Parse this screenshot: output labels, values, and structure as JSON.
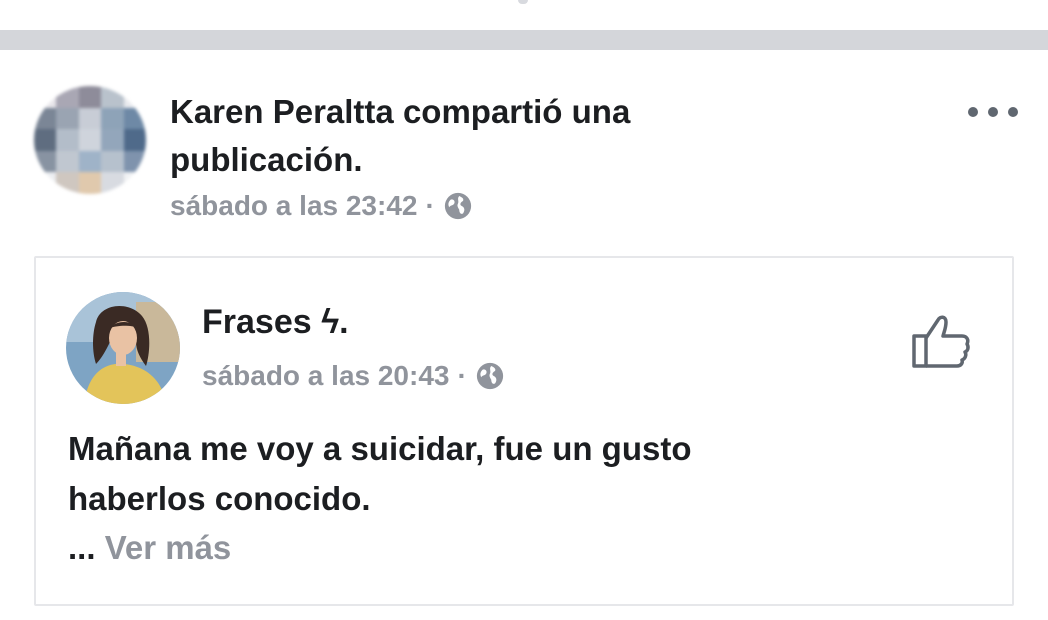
{
  "share_header": {
    "sharer_name": "Karen Peraltta",
    "action_line1": "compartió una",
    "action_line2": "publicación.",
    "timestamp": "sábado a las 23:42",
    "separator": "·",
    "privacy_icon": "globe-icon",
    "menu_icon": "more-options-icon"
  },
  "shared_post": {
    "page_name": "Frases ϟ.",
    "timestamp": "sábado a las 20:43",
    "separator": "·",
    "privacy_icon": "globe-icon",
    "like_icon": "thumbs-up-icon",
    "text_line1": "Mañana me voy a suicidar, fue un gusto",
    "text_line2": "haberlos conocido.",
    "ellipsis": "...",
    "see_more": "Ver más"
  },
  "colors": {
    "text_primary": "#1c1e21",
    "text_secondary": "#90949c",
    "separator": "#d4d6da",
    "border": "#e6e7ea"
  }
}
